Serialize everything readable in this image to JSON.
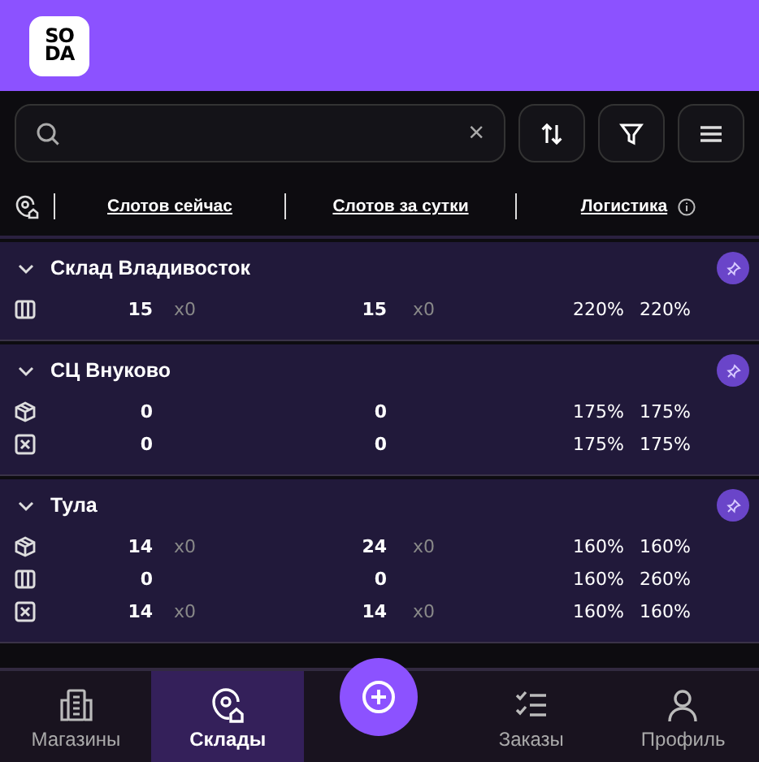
{
  "header": {
    "logo": [
      "SO",
      "DA"
    ]
  },
  "search": {
    "clear": "×"
  },
  "columns": [
    "Слотов сейчас",
    "Слотов за сутки",
    "Логистика"
  ],
  "warehouses": [
    {
      "name": "Склад Владивосток",
      "expanded": true,
      "rows": [
        {
          "kind": "pallet",
          "now": "15",
          "now_coef": "x0",
          "day": "15",
          "day_coef": "x0",
          "log1": "220%",
          "log2": "220%"
        }
      ]
    },
    {
      "name": "СЦ Внуково",
      "expanded": true,
      "rows": [
        {
          "kind": "box",
          "now": "0",
          "day": "0",
          "log1": "175%",
          "log2": "175%"
        },
        {
          "kind": "supersafe",
          "now": "0",
          "day": "0",
          "log1": "175%",
          "log2": "175%"
        }
      ]
    },
    {
      "name": "Тула",
      "expanded": true,
      "rows": [
        {
          "kind": "box",
          "now": "14",
          "now_coef": "x0",
          "day": "24",
          "day_coef": "x0",
          "log1": "160%",
          "log2": "160%"
        },
        {
          "kind": "pallet",
          "now": "0",
          "day": "0",
          "log1": "160%",
          "log2": "260%"
        },
        {
          "kind": "supersafe",
          "now": "14",
          "now_coef": "x0",
          "day": "14",
          "day_coef": "x0",
          "log1": "160%",
          "log2": "160%"
        }
      ]
    }
  ],
  "nav": [
    {
      "kind": "shops",
      "label": "Магазины",
      "selected": false
    },
    {
      "kind": "warehouses",
      "label": "Склады",
      "selected": true
    },
    {
      "kind": "add"
    },
    {
      "kind": "orders",
      "label": "Заказы",
      "selected": false
    },
    {
      "kind": "profile",
      "label": "Профиль",
      "selected": false
    }
  ]
}
